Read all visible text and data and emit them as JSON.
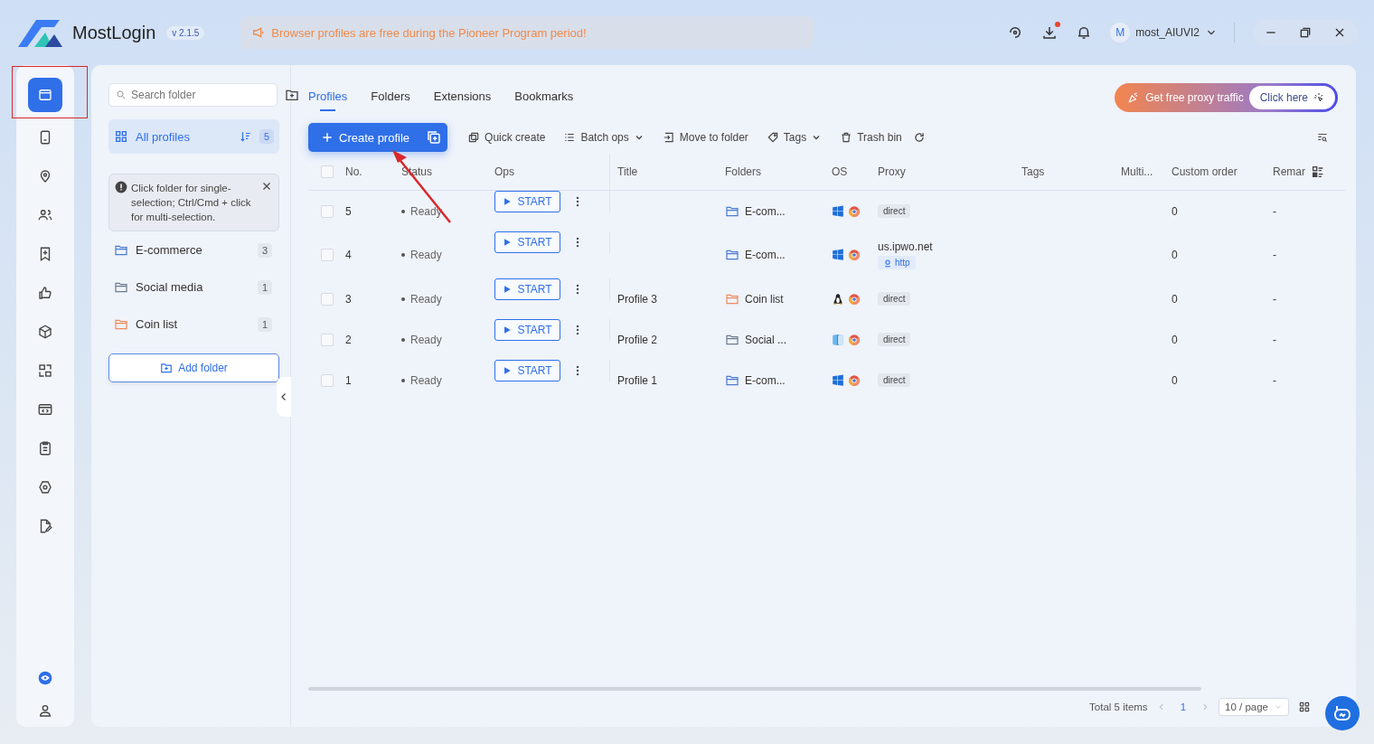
{
  "app": {
    "name": "MostLogin",
    "version": "v 2.1.5",
    "notice": "Browser profiles are free during the Pioneer Program period!",
    "user": {
      "initial": "M",
      "name": "most_AIUVI2"
    }
  },
  "rail": [
    {
      "selected": true
    },
    {
      "selected": false
    },
    {
      "selected": false
    },
    {
      "selected": false
    },
    {
      "selected": false
    },
    {
      "selected": false
    },
    {
      "selected": false
    },
    {
      "selected": false
    },
    {
      "selected": false
    },
    {
      "selected": false
    },
    {
      "selected": false
    },
    {
      "selected": false
    }
  ],
  "folders": {
    "search_placeholder": "Search folder",
    "all": {
      "label": "All profiles",
      "count": "5",
      "selected": true
    },
    "hint": "Click folder for single-selection; Ctrl/Cmd + click for multi-selection.",
    "items": [
      {
        "name": "E-commerce",
        "count": "3",
        "color": "#4a7bd0",
        "selected": false
      },
      {
        "name": "Social media",
        "count": "1",
        "color": "#6b7b8f",
        "selected": false
      },
      {
        "name": "Coin list",
        "count": "1",
        "color": "#f08a5d",
        "selected": false
      }
    ],
    "add_button": "Add folder"
  },
  "tabs": [
    {
      "label": "Profiles",
      "selected": true
    },
    {
      "label": "Folders",
      "selected": false
    },
    {
      "label": "Extensions",
      "selected": false
    },
    {
      "label": "Bookmarks",
      "selected": false
    }
  ],
  "promo": {
    "text": "Get free proxy traffic",
    "button": "Click here"
  },
  "toolbar": {
    "create": "Create profile",
    "actions": [
      {
        "label": "Quick create",
        "kind": "copy",
        "dropdown": false
      },
      {
        "label": "Batch ops",
        "kind": "list",
        "dropdown": true
      },
      {
        "label": "Move to folder",
        "kind": "move",
        "dropdown": false
      },
      {
        "label": "Tags",
        "kind": "tag",
        "dropdown": true
      },
      {
        "label": "Trash bin",
        "kind": "trash",
        "dropdown": false
      }
    ]
  },
  "table": {
    "all_checked": false,
    "columns": [
      "No.",
      "Status",
      "Ops",
      "Title",
      "Folders",
      "OS",
      "Proxy",
      "Tags",
      "Multi...",
      "Custom order",
      "Remar"
    ],
    "rows": [
      {
        "checked": false,
        "no": "5",
        "status": "Ready",
        "action": "START",
        "folder": "E-com...",
        "color": "#4a7bd0",
        "os": {
          "kind": "windows"
        },
        "proxy": {
          "label": "direct"
        },
        "order": "0",
        "remark": "-"
      },
      {
        "checked": false,
        "no": "4",
        "status": "Ready",
        "action": "START",
        "folder": "E-com...",
        "color": "#4a7bd0",
        "os": {
          "kind": "windows"
        },
        "proxy": {
          "host": "us.ipwo.net",
          "protocol": "http"
        },
        "order": "0",
        "remark": "-"
      },
      {
        "checked": false,
        "no": "3",
        "status": "Ready",
        "action": "START",
        "title": "Profile 3",
        "folder": "Coin list",
        "color": "#f08a5d",
        "os": {
          "kind": "linux"
        },
        "proxy": {
          "label": "direct"
        },
        "order": "0",
        "remark": "-"
      },
      {
        "checked": false,
        "no": "2",
        "status": "Ready",
        "action": "START",
        "title": "Profile 2",
        "folder": "Social ...",
        "color": "#6b7b8f",
        "os": {
          "kind": "mac"
        },
        "proxy": {
          "label": "direct"
        },
        "order": "0",
        "remark": "-"
      },
      {
        "checked": false,
        "no": "1",
        "status": "Ready",
        "action": "START",
        "title": "Profile 1",
        "folder": "E-com...",
        "color": "#4a7bd0",
        "os": {
          "kind": "windows"
        },
        "proxy": {
          "label": "direct"
        },
        "order": "0",
        "remark": "-"
      }
    ]
  },
  "pagination": {
    "total": "Total 5 items",
    "page": "1",
    "page_size": "10 / page"
  }
}
